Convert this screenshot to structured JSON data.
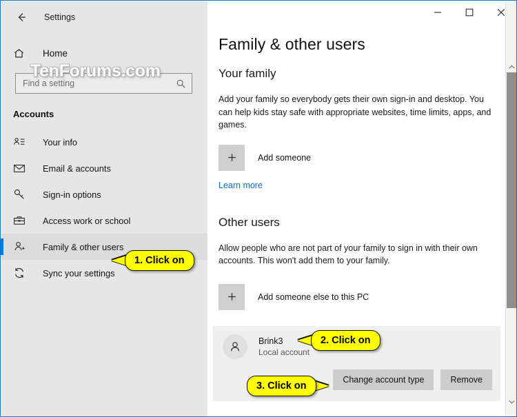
{
  "window": {
    "title": "Settings",
    "back_icon": "back-arrow-icon",
    "minimize_label": "—",
    "maximize_label": "☐",
    "close_label": "✕",
    "accent_color": "#0078d7"
  },
  "watermark": {
    "text": "TenForums.com"
  },
  "sidebar": {
    "home_label": "Home",
    "home_icon": "home-icon",
    "search": {
      "placeholder": "Find a setting",
      "value": "",
      "icon": "search-icon"
    },
    "section_label": "Accounts",
    "items": [
      {
        "label": "Your info",
        "icon": "contact-card-icon",
        "selected": false
      },
      {
        "label": "Email & accounts",
        "icon": "envelope-icon",
        "selected": false
      },
      {
        "label": "Sign-in options",
        "icon": "key-icon",
        "selected": false
      },
      {
        "label": "Access work or school",
        "icon": "briefcase-icon",
        "selected": false
      },
      {
        "label": "Family & other users",
        "icon": "person-add-icon",
        "selected": true
      },
      {
        "label": "Sync your settings",
        "icon": "sync-icon",
        "selected": false
      }
    ]
  },
  "main": {
    "page_title": "Family & other users",
    "your_family": {
      "heading": "Your family",
      "description": "Add your family so everybody gets their own sign-in and desktop. You can help kids stay safe with appropriate websites, time limits, apps, and games.",
      "add_label": "Add someone",
      "add_icon": "plus-icon",
      "learn_more": "Learn more",
      "link_color": "#0b69c7"
    },
    "other_users": {
      "heading": "Other users",
      "description": "Allow people who are not part of your family to sign in with their own accounts. This won't add them to your family.",
      "add_label": "Add someone else to this PC",
      "add_icon": "plus-icon",
      "account": {
        "name": "Brink3",
        "type": "Local account",
        "avatar_icon": "person-icon",
        "change_button": "Change account type",
        "remove_button": "Remove"
      }
    }
  },
  "scrollbar": {
    "up_icon": "chevron-up-icon",
    "down_icon": "chevron-down-icon"
  },
  "callouts": [
    {
      "text": "1. Click on"
    },
    {
      "text": "2. Click on"
    },
    {
      "text": "3. Click on"
    }
  ]
}
